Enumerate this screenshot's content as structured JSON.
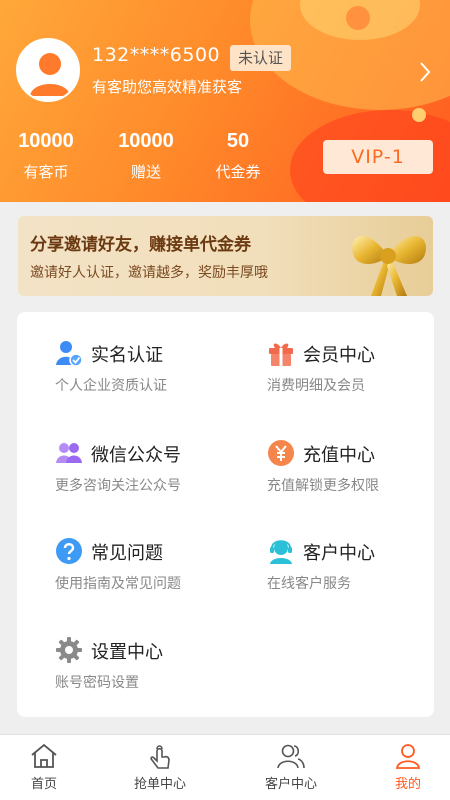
{
  "profile": {
    "phone": "132****6500",
    "auth_status": "未认证",
    "slogan": "有客助您高效精准获客",
    "vip_level": "VIP-1"
  },
  "stats": [
    {
      "value": "10000",
      "label": "有客币"
    },
    {
      "value": "10000",
      "label": "赠送"
    },
    {
      "value": "50",
      "label": "代金券"
    }
  ],
  "banner": {
    "title": "分享邀请好友，赚接单代金券",
    "subtitle": "邀请好人认证，邀请越多，奖励丰厚哦"
  },
  "menu": [
    {
      "title": "实名认证",
      "subtitle": "个人企业资质认证",
      "icon": "verify-user-icon",
      "color": "#3d8cf5"
    },
    {
      "title": "会员中心",
      "subtitle": "消费明细及会员",
      "icon": "gift-icon",
      "color": "#f26a4b"
    },
    {
      "title": "微信公众号",
      "subtitle": "更多咨询关注公众号",
      "icon": "group-icon",
      "color": "#9b6af0"
    },
    {
      "title": "充值中心",
      "subtitle": "充值解锁更多权限",
      "icon": "yuan-icon",
      "color": "#f5864b"
    },
    {
      "title": "常见问题",
      "subtitle": "使用指南及常见问题",
      "icon": "question-icon",
      "color": "#3d9af5"
    },
    {
      "title": "客户中心",
      "subtitle": "在线客户服务",
      "icon": "customer-service-icon",
      "color": "#2cc0d8"
    },
    {
      "title": "设置中心",
      "subtitle": "账号密码设置",
      "icon": "gear-icon",
      "color": "#8a8a8a"
    }
  ],
  "nav": [
    {
      "label": "首页",
      "icon": "home-icon",
      "active": false
    },
    {
      "label": "抢单中心",
      "icon": "tap-hand-icon",
      "active": false
    },
    {
      "label": "客户中心",
      "icon": "users-icon",
      "active": false
    },
    {
      "label": "我的",
      "icon": "person-icon",
      "active": true
    }
  ]
}
